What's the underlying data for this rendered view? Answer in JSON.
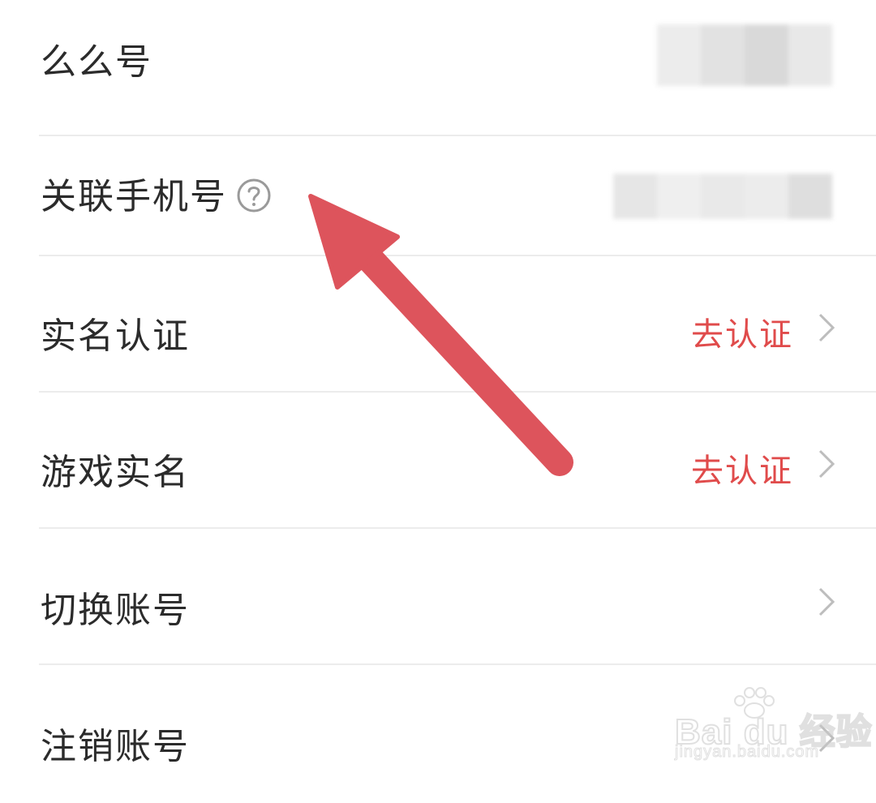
{
  "settings": {
    "rows": [
      {
        "label": "么么号",
        "value": "",
        "action": ""
      },
      {
        "label": "关联手机号",
        "value": "",
        "action": ""
      },
      {
        "label": "实名认证",
        "action": "去认证"
      },
      {
        "label": "游戏实名",
        "action": "去认证"
      },
      {
        "label": "切换账号",
        "action": ""
      },
      {
        "label": "注销账号",
        "action": ""
      }
    ]
  },
  "icons": {
    "help": "question-circle-icon",
    "chevron": "chevron-right-icon",
    "annotation": "red-arrow-pointer"
  },
  "watermark": {
    "brand": "Bai du 经验",
    "url": "jingyan.baidu.com"
  },
  "colors": {
    "action": "#e04b4b",
    "label": "#2b2b2b",
    "divider": "#ececec",
    "chevron": "#bdbdbd",
    "arrow": "#dd545c"
  }
}
